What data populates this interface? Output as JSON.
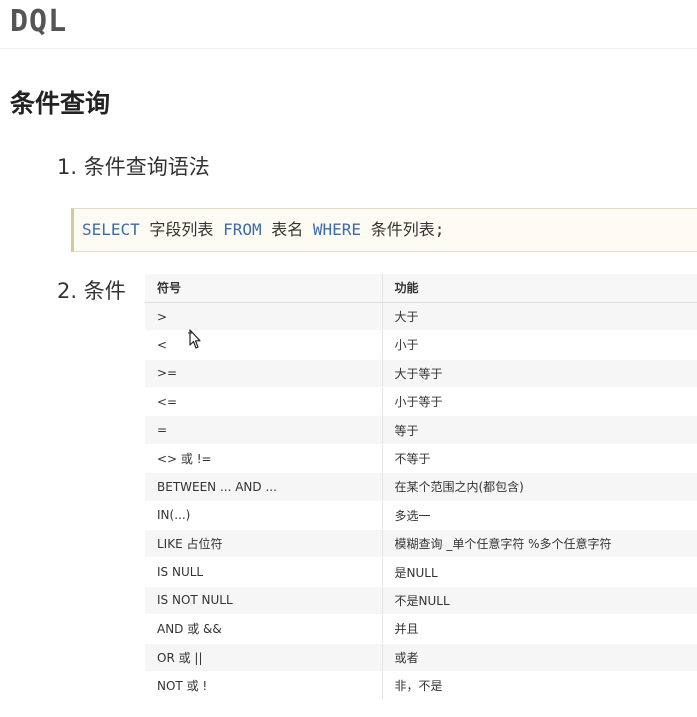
{
  "document": {
    "title": "DQL",
    "section_heading": "条件查询",
    "items": [
      {
        "label": "1. 条件查询语法"
      },
      {
        "label": "2. 条件"
      }
    ]
  },
  "code": {
    "kw_select": "SELECT",
    "fields": " 字段列表 ",
    "kw_from": "FROM",
    "table": " 表名 ",
    "kw_where": "WHERE",
    "conditions": " 条件列表;"
  },
  "conditions_table": {
    "headers": [
      "符号",
      "功能"
    ],
    "rows": [
      [
        ">",
        "大于"
      ],
      [
        "<",
        "小于"
      ],
      [
        ">=",
        "大于等于"
      ],
      [
        "<=",
        "小于等于"
      ],
      [
        "=",
        "等于"
      ],
      [
        "<> 或 !=",
        "不等于"
      ],
      [
        "BETWEEN ... AND ...",
        "在某个范围之内(都包含)"
      ],
      [
        "IN(...)",
        "多选一"
      ],
      [
        "LIKE 占位符",
        "模糊查询 _单个任意字符 %多个任意字符"
      ],
      [
        "IS NULL",
        "是NULL"
      ],
      [
        "IS NOT NULL",
        "不是NULL"
      ],
      [
        "AND 或 &&",
        "并且"
      ],
      [
        "OR 或 ||",
        "或者"
      ],
      [
        "NOT 或 !",
        "非，不是"
      ]
    ]
  },
  "icons": {
    "cursor": "move-cursor-icon"
  }
}
